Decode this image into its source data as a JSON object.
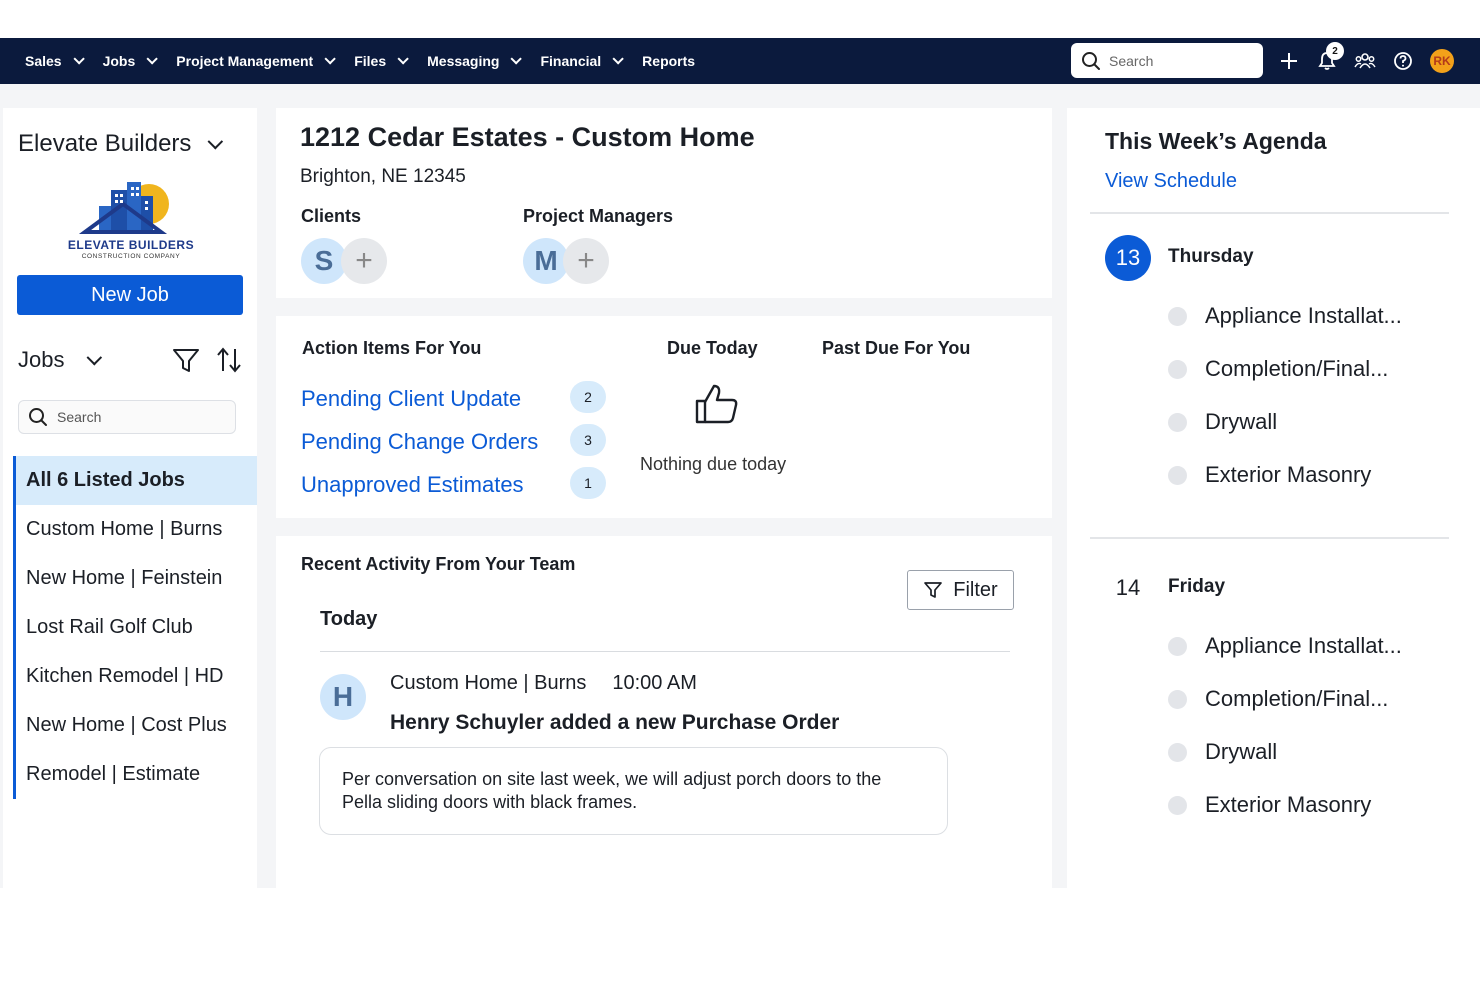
{
  "nav": {
    "items": [
      {
        "label": "Sales",
        "dropdown": true
      },
      {
        "label": "Jobs",
        "dropdown": true
      },
      {
        "label": "Project Management",
        "dropdown": true
      },
      {
        "label": "Files",
        "dropdown": true
      },
      {
        "label": "Messaging",
        "dropdown": true
      },
      {
        "label": "Financial",
        "dropdown": true
      },
      {
        "label": "Reports",
        "dropdown": false
      }
    ],
    "search_placeholder": "Search",
    "notification_count": "2",
    "user_initials": "RK",
    "colors": {
      "bar": "#0b1a3d",
      "accent": "#0b5bd6"
    }
  },
  "sidebar": {
    "company_name": "Elevate Builders",
    "logo_name": "ELEVATE BUILDERS",
    "logo_sub": "CONSTRUCTION COMPANY",
    "new_job_label": "New Job",
    "jobs_label": "Jobs",
    "search_placeholder": "Search",
    "jobs": [
      "All 6 Listed Jobs",
      "Custom Home | Burns",
      "New Home | Feinstein",
      "Lost Rail Golf Club",
      "Kitchen Remodel | HD",
      "New Home | Cost Plus",
      "Remodel | Estimate"
    ]
  },
  "project": {
    "title": "1212 Cedar Estates - Custom Home",
    "address": "Brighton, NE 12345",
    "clients_label": "Clients",
    "client_initial": "S",
    "managers_label": "Project Managers",
    "manager_initial": "M"
  },
  "actions": {
    "heading": "Action Items For You",
    "items": [
      {
        "label": "Pending Client Update",
        "count": "2"
      },
      {
        "label": "Pending Change Orders",
        "count": "3"
      },
      {
        "label": "Unapproved Estimates",
        "count": "1"
      }
    ],
    "due_today_label": "Due Today",
    "nothing_due": "Nothing due today",
    "past_due_label": "Past Due For You"
  },
  "activity": {
    "heading": "Recent Activity From Your Team",
    "filter_label": "Filter",
    "group_label": "Today",
    "entry": {
      "initial": "H",
      "job": "Custom Home | Burns",
      "time": "10:00 AM",
      "title": "Henry Schuyler added a new Purchase Order",
      "note": "Per conversation on site last week, we will adjust porch doors to the Pella sliding doors with black frames."
    }
  },
  "agenda": {
    "title": "This Week’s Agenda",
    "view_schedule": "View Schedule",
    "days": [
      {
        "number": "13",
        "name": "Thursday",
        "current": true,
        "items": [
          "Appliance Installat...",
          "Completion/Final...",
          "Drywall",
          "Exterior Masonry"
        ]
      },
      {
        "number": "14",
        "name": "Friday",
        "current": false,
        "items": [
          "Appliance Installat...",
          "Completion/Final...",
          "Drywall",
          "Exterior Masonry"
        ]
      }
    ]
  }
}
